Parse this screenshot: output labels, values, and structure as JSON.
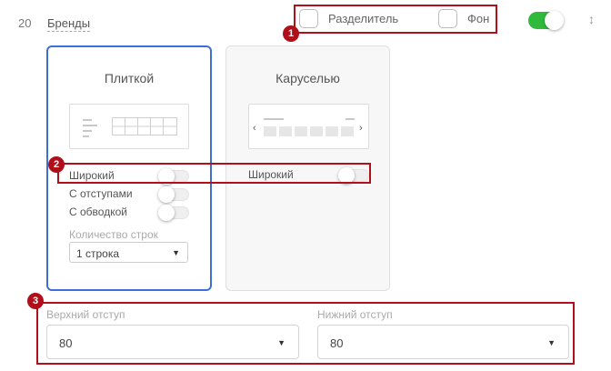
{
  "block": {
    "number": "20",
    "title": "Бренды"
  },
  "header_options": {
    "divider_label": "Разделитель",
    "background_label": "Фон"
  },
  "layout_tiles": {
    "label": "Плиткой",
    "options": {
      "wide": "Широкий",
      "padding": "С отступами",
      "border": "С обводкой"
    },
    "rows": {
      "label": "Количество строк",
      "value": "1 строка"
    }
  },
  "layout_carousel": {
    "label": "Каруселью",
    "options": {
      "wide": "Широкий"
    },
    "arrows": {
      "left": "‹",
      "right": "›"
    }
  },
  "spacing": {
    "top": {
      "label": "Верхний отступ",
      "value": "80"
    },
    "bottom": {
      "label": "Нижний отступ",
      "value": "80"
    }
  },
  "annotations": [
    "1",
    "2",
    "3"
  ],
  "icons": {
    "dropdown": "▼",
    "sort": "↕"
  },
  "colors": {
    "accent_green": "#30b93b",
    "selected_blue": "#3d6fd6",
    "annotation_red": "#b0101a"
  },
  "state": {
    "block_enabled": true,
    "selected_layout": "tiles",
    "toggles_on": false
  }
}
